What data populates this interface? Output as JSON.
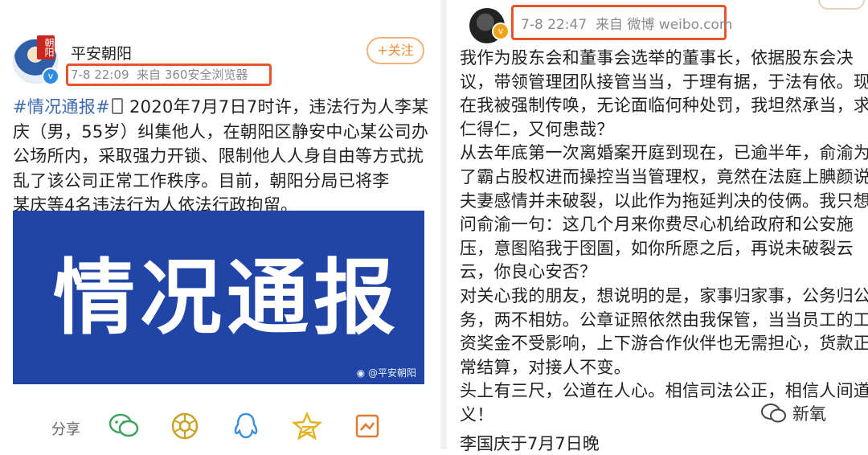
{
  "left_post": {
    "username": "平安朝阳",
    "avatar_seal": "朝阳",
    "timestamp": "7-8 22:09",
    "source": "来自 360安全浏览器",
    "follow_label": "+关注",
    "lines": [
      [
        "#情况通报#",
        "2020年7月7日7时许，违法行为人李某"
      ],
      [
        "",
        "庆（男，55岁）纠集他人，在朝阳区静安中心某公司办"
      ],
      [
        "",
        "公场所内，采取强力开锁、限制他人人身自由等方式扰"
      ],
      [
        "",
        "乱了该公司正常工作秩序。目前，朝阳分局已将李"
      ],
      [
        "",
        "某庆等4名违法行为人依法行政拘留。"
      ]
    ],
    "image_title": "情况通报",
    "image_watermark": "@平安朝阳",
    "actions": {
      "share_label": "分享",
      "icons": [
        "wechat-icon",
        "moments-icon",
        "qq-icon",
        "qzone-icon",
        "screenshot-icon"
      ]
    }
  },
  "right_post": {
    "timestamp": "7-8 22:47",
    "source": "来自 微博 weibo.com",
    "lines": [
      "我作为股东会和董事会选举的董事长，依据股东会决",
      "议，带领管理团队接管当当，于理有据，于法有依。现",
      "在我被强制传唤，无论面临何种处罚，我坦然承当，求",
      "仁得仁，又何患哉？",
      "从去年底第一次离婚案开庭到现在，已逾半年，俞渝为",
      "了霸占股权进而操控当当管理权，竟然在法庭上腆颜说",
      "夫妻感情并未破裂，以此作为拖延判决的伎俩。我只想",
      "问俞渝一句：这几个月来你费尽心机给政府和公安施",
      "压，意图陷我于囹圄，如你所愿之后，再说未破裂云",
      "云，你良心安否？",
      "对关心我的朋友，想说明的是，家事归家事，公务归公",
      "务，两不相妨。公章证照依然由我保管，当当员工的工",
      "资奖金不受影响，上下游合作伙伴也无需担心，货款正",
      "常结算，对接人不变。",
      "头上有三尺，公道在人心。相信司法公正，相信人间道",
      "义！"
    ],
    "signature": "李国庆于7月7日晚",
    "watermark_text": "新氧"
  },
  "colors": {
    "highlight_box": "#e8542a",
    "follow": "#ef8a35",
    "hashtag": "#3c6bb0",
    "banner": "#2145a6"
  }
}
